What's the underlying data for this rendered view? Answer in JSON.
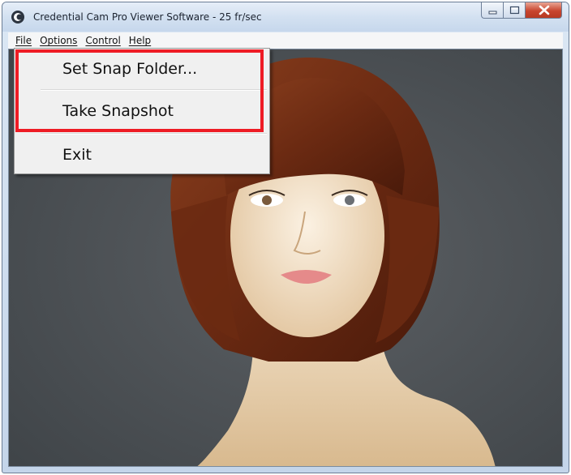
{
  "window": {
    "title": "Credential Cam Pro Viewer Software - 25 fr/sec",
    "app_icon": "camera-app-icon",
    "controls": [
      "minimize-icon",
      "maximize-icon",
      "close-icon"
    ]
  },
  "menubar": {
    "items": [
      {
        "label": "File"
      },
      {
        "label": "Options"
      },
      {
        "label": "Control"
      },
      {
        "label": "Help"
      }
    ]
  },
  "file_menu": {
    "items": [
      {
        "label": "Set Snap Folder..."
      },
      {
        "label": "Take Snapshot"
      },
      {
        "label": "Exit"
      }
    ]
  },
  "annotation": {
    "color": "#ee1c25"
  },
  "video": {
    "subject": "mannequin-head-with-auburn-bob-wig"
  }
}
